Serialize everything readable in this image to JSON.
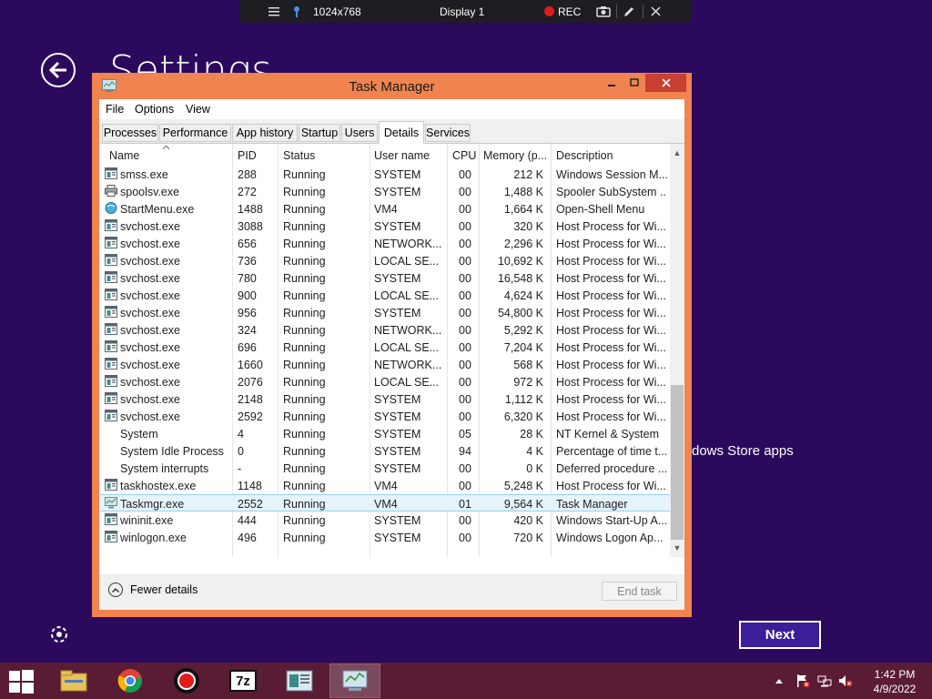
{
  "remote_toolbar": {
    "resolution": "1024x768",
    "display": "Display 1",
    "rec_label": "REC"
  },
  "settings": {
    "title": "Settings",
    "store_text": "dows Store apps",
    "next_label": "Next"
  },
  "task_manager": {
    "title": "Task Manager",
    "menu": [
      "File",
      "Options",
      "View"
    ],
    "tabs": [
      "Processes",
      "Performance",
      "App history",
      "Startup",
      "Users",
      "Details",
      "Services"
    ],
    "active_tab": "Details",
    "columns": [
      "Name",
      "PID",
      "Status",
      "User name",
      "CPU",
      "Memory (p...",
      "Description"
    ],
    "rows": [
      {
        "name": "smss.exe",
        "pid": "288",
        "status": "Running",
        "user": "SYSTEM",
        "cpu": "00",
        "mem": "212 K",
        "desc": "Windows Session M...",
        "icon": "app-window-icon"
      },
      {
        "name": "spoolsv.exe",
        "pid": "272",
        "status": "Running",
        "user": "SYSTEM",
        "cpu": "00",
        "mem": "1,488 K",
        "desc": "Spooler SubSystem ...",
        "icon": "printer-icon"
      },
      {
        "name": "StartMenu.exe",
        "pid": "1488",
        "status": "Running",
        "user": "VM4",
        "cpu": "00",
        "mem": "1,664 K",
        "desc": "Open-Shell Menu",
        "icon": "shell-orb-icon"
      },
      {
        "name": "svchost.exe",
        "pid": "3088",
        "status": "Running",
        "user": "SYSTEM",
        "cpu": "00",
        "mem": "320 K",
        "desc": "Host Process for Wi...",
        "icon": "app-window-icon"
      },
      {
        "name": "svchost.exe",
        "pid": "656",
        "status": "Running",
        "user": "NETWORK...",
        "cpu": "00",
        "mem": "2,296 K",
        "desc": "Host Process for Wi...",
        "icon": "app-window-icon"
      },
      {
        "name": "svchost.exe",
        "pid": "736",
        "status": "Running",
        "user": "LOCAL SE...",
        "cpu": "00",
        "mem": "10,692 K",
        "desc": "Host Process for Wi...",
        "icon": "app-window-icon"
      },
      {
        "name": "svchost.exe",
        "pid": "780",
        "status": "Running",
        "user": "SYSTEM",
        "cpu": "00",
        "mem": "16,548 K",
        "desc": "Host Process for Wi...",
        "icon": "app-window-icon"
      },
      {
        "name": "svchost.exe",
        "pid": "900",
        "status": "Running",
        "user": "LOCAL SE...",
        "cpu": "00",
        "mem": "4,624 K",
        "desc": "Host Process for Wi...",
        "icon": "app-window-icon"
      },
      {
        "name": "svchost.exe",
        "pid": "956",
        "status": "Running",
        "user": "SYSTEM",
        "cpu": "00",
        "mem": "54,800 K",
        "desc": "Host Process for Wi...",
        "icon": "app-window-icon"
      },
      {
        "name": "svchost.exe",
        "pid": "324",
        "status": "Running",
        "user": "NETWORK...",
        "cpu": "00",
        "mem": "5,292 K",
        "desc": "Host Process for Wi...",
        "icon": "app-window-icon"
      },
      {
        "name": "svchost.exe",
        "pid": "696",
        "status": "Running",
        "user": "LOCAL SE...",
        "cpu": "00",
        "mem": "7,204 K",
        "desc": "Host Process for Wi...",
        "icon": "app-window-icon"
      },
      {
        "name": "svchost.exe",
        "pid": "1660",
        "status": "Running",
        "user": "NETWORK...",
        "cpu": "00",
        "mem": "568 K",
        "desc": "Host Process for Wi...",
        "icon": "app-window-icon"
      },
      {
        "name": "svchost.exe",
        "pid": "2076",
        "status": "Running",
        "user": "LOCAL SE...",
        "cpu": "00",
        "mem": "972 K",
        "desc": "Host Process for Wi...",
        "icon": "app-window-icon"
      },
      {
        "name": "svchost.exe",
        "pid": "2148",
        "status": "Running",
        "user": "SYSTEM",
        "cpu": "00",
        "mem": "1,112 K",
        "desc": "Host Process for Wi...",
        "icon": "app-window-icon"
      },
      {
        "name": "svchost.exe",
        "pid": "2592",
        "status": "Running",
        "user": "SYSTEM",
        "cpu": "00",
        "mem": "6,320 K",
        "desc": "Host Process for Wi...",
        "icon": "app-window-icon"
      },
      {
        "name": "System",
        "pid": "4",
        "status": "Running",
        "user": "SYSTEM",
        "cpu": "05",
        "mem": "28 K",
        "desc": "NT Kernel & System",
        "icon": "none"
      },
      {
        "name": "System Idle Process",
        "pid": "0",
        "status": "Running",
        "user": "SYSTEM",
        "cpu": "94",
        "mem": "4 K",
        "desc": "Percentage of time t...",
        "icon": "none"
      },
      {
        "name": "System interrupts",
        "pid": "-",
        "status": "Running",
        "user": "SYSTEM",
        "cpu": "00",
        "mem": "0 K",
        "desc": "Deferred procedure ...",
        "icon": "none"
      },
      {
        "name": "taskhostex.exe",
        "pid": "1148",
        "status": "Running",
        "user": "VM4",
        "cpu": "00",
        "mem": "5,248 K",
        "desc": "Host Process for Wi...",
        "icon": "app-window-icon"
      },
      {
        "name": "Taskmgr.exe",
        "pid": "2552",
        "status": "Running",
        "user": "VM4",
        "cpu": "01",
        "mem": "9,564 K",
        "desc": "Task Manager",
        "icon": "task-manager-icon",
        "selected": true
      },
      {
        "name": "wininit.exe",
        "pid": "444",
        "status": "Running",
        "user": "SYSTEM",
        "cpu": "00",
        "mem": "420 K",
        "desc": "Windows Start-Up A...",
        "icon": "app-window-icon"
      },
      {
        "name": "winlogon.exe",
        "pid": "496",
        "status": "Running",
        "user": "SYSTEM",
        "cpu": "00",
        "mem": "720 K",
        "desc": "Windows Logon Ap...",
        "icon": "app-window-icon"
      }
    ],
    "fewer_details_label": "Fewer details",
    "end_task_label": "End task"
  },
  "taskbar": {
    "apps": [
      "file-explorer-icon",
      "chrome-icon",
      "record-icon",
      "7zip-icon",
      "window-app-icon",
      "task-manager-icon"
    ],
    "seven_zip_label": "7z",
    "clock_time": "1:42 PM",
    "clock_date": "4/9/2022"
  },
  "colors": {
    "desktop_bg": "#2b0a5e",
    "window_frame": "#f0834f",
    "close_button": "#c84031",
    "taskbar": "#5a1c34",
    "selection_bg": "#e5f3fb"
  }
}
